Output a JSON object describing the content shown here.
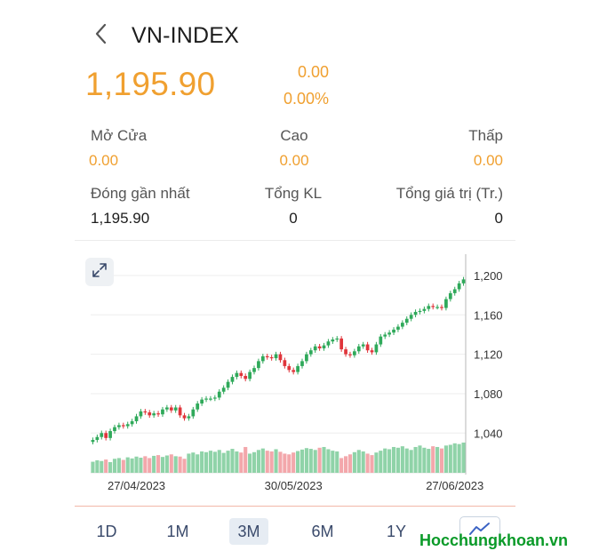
{
  "header": {
    "title": "VN-INDEX",
    "back_icon": "chevron-left-icon"
  },
  "quote": {
    "price": "1,195.90",
    "change": "0.00",
    "change_pct": "0.00%"
  },
  "stats": {
    "open_label": "Mở Cửa",
    "open_value": "0.00",
    "high_label": "Cao",
    "high_value": "0.00",
    "low_label": "Thấp",
    "low_value": "0.00",
    "prev_close_label": "Đóng gần nhất",
    "prev_close_value": "1,195.90",
    "volume_label": "Tổng KL",
    "volume_value": "0",
    "total_value_label": "Tổng giá trị (Tr.)",
    "total_value_value": "0"
  },
  "tabs": [
    {
      "label": "1D",
      "active": false
    },
    {
      "label": "1M",
      "active": false
    },
    {
      "label": "3M",
      "active": true
    },
    {
      "label": "6M",
      "active": false
    },
    {
      "label": "1Y",
      "active": false
    }
  ],
  "watermark": "Hocchungkhoan.vn",
  "colors": {
    "accent_orange": "#f0a030",
    "up_green": "#2fa95a",
    "down_red": "#e0353b",
    "up_volume": "#8fd3a8",
    "down_volume": "#f3a7ab"
  },
  "chart_data": {
    "type": "candlestick",
    "ylim": [
      1015,
      1218
    ],
    "y_ticks": [
      "1,200",
      "1,160",
      "1,120",
      "1,080",
      "1,040"
    ],
    "y_tick_values": [
      1200,
      1160,
      1120,
      1080,
      1040
    ],
    "x_tick_labels": [
      "27/04/2023",
      "30/05/2023",
      "27/06/2023"
    ],
    "x_tick_indices": [
      10,
      46,
      83
    ],
    "closes": [
      1033,
      1036,
      1040,
      1035,
      1042,
      1046,
      1048,
      1047,
      1049,
      1052,
      1057,
      1062,
      1061,
      1058,
      1060,
      1059,
      1064,
      1066,
      1063,
      1066,
      1058,
      1055,
      1057,
      1064,
      1070,
      1074,
      1075,
      1075,
      1076,
      1082,
      1086,
      1092,
      1097,
      1101,
      1098,
      1095,
      1102,
      1106,
      1113,
      1118,
      1117,
      1116,
      1120,
      1114,
      1108,
      1104,
      1102,
      1108,
      1113,
      1120,
      1124,
      1128,
      1126,
      1129,
      1133,
      1135,
      1136,
      1125,
      1120,
      1119,
      1123,
      1128,
      1130,
      1124,
      1122,
      1130,
      1138,
      1140,
      1142,
      1145,
      1148,
      1152,
      1156,
      1160,
      1163,
      1164,
      1166,
      1169,
      1168,
      1168,
      1167,
      1176,
      1182,
      1186,
      1192,
      1196
    ],
    "volumes": [
      0.3,
      0.34,
      0.32,
      0.36,
      0.29,
      0.38,
      0.4,
      0.35,
      0.42,
      0.39,
      0.44,
      0.41,
      0.45,
      0.4,
      0.46,
      0.48,
      0.43,
      0.47,
      0.5,
      0.45,
      0.44,
      0.38,
      0.52,
      0.55,
      0.5,
      0.58,
      0.56,
      0.6,
      0.57,
      0.62,
      0.54,
      0.6,
      0.65,
      0.58,
      0.55,
      0.7,
      0.52,
      0.56,
      0.62,
      0.66,
      0.6,
      0.58,
      0.64,
      0.57,
      0.52,
      0.5,
      0.55,
      0.59,
      0.63,
      0.67,
      0.65,
      0.62,
      0.68,
      0.7,
      0.64,
      0.6,
      0.58,
      0.4,
      0.45,
      0.5,
      0.56,
      0.62,
      0.58,
      0.52,
      0.48,
      0.55,
      0.6,
      0.66,
      0.64,
      0.7,
      0.68,
      0.72,
      0.66,
      0.62,
      0.7,
      0.74,
      0.68,
      0.65,
      0.72,
      0.7,
      0.66,
      0.74,
      0.76,
      0.8,
      0.78,
      0.82
    ]
  }
}
